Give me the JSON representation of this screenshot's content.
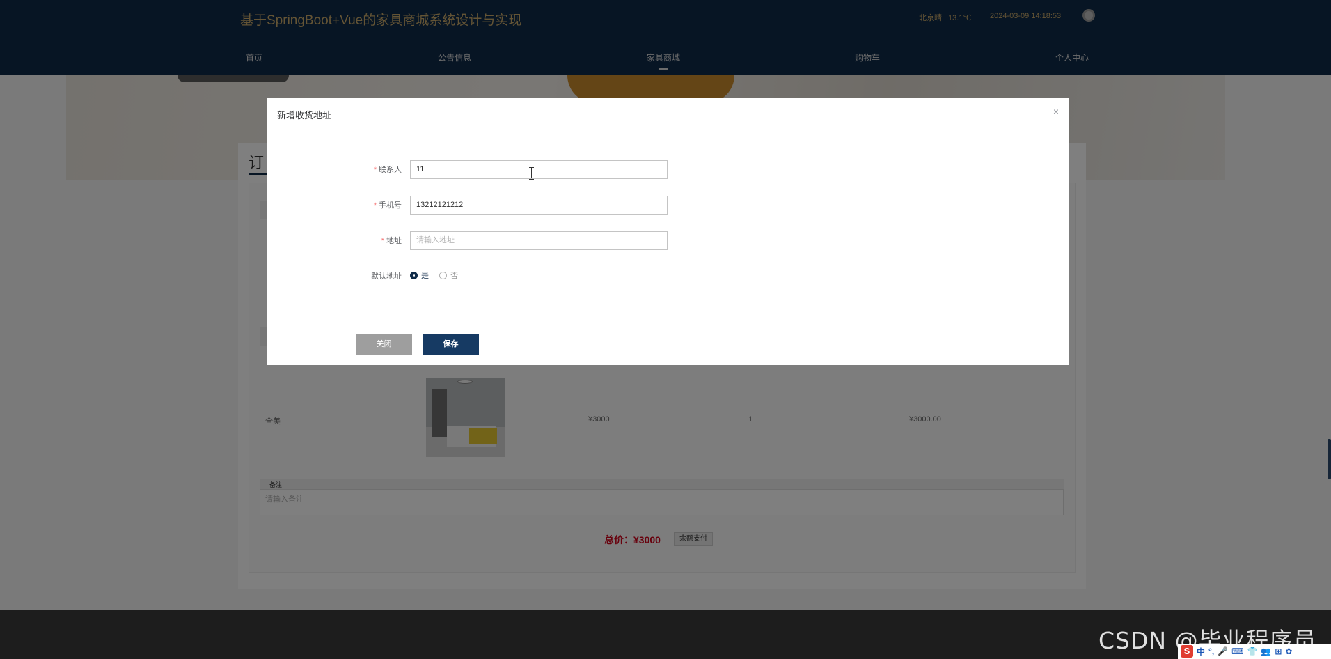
{
  "header": {
    "site_title": "基于SpringBoot+Vue的家具商城系统设计与实现",
    "weather": "北京晴 | 13.1℃",
    "datetime": "2024-03-09  14:18:53"
  },
  "nav": {
    "items": [
      {
        "label": "首页",
        "active": false
      },
      {
        "label": "公告信息",
        "active": false
      },
      {
        "label": "家具商城",
        "active": true
      },
      {
        "label": "购物车",
        "active": false
      },
      {
        "label": "个人中心",
        "active": false
      }
    ]
  },
  "order": {
    "tab_label": "订",
    "row": {
      "name": "全美",
      "price": "¥3000",
      "quantity": "1",
      "subtotal": "¥3000.00"
    },
    "remark_label": "备注",
    "remark_placeholder": "请输入备注",
    "total_label": "总价：¥3000",
    "pay_button": "余额支付"
  },
  "modal": {
    "title": "新增收货地址",
    "close_icon": "×",
    "fields": {
      "contact": {
        "label": "联系人",
        "value": "11"
      },
      "phone": {
        "label": "手机号",
        "value": "13212121212"
      },
      "address": {
        "label": "地址",
        "placeholder": "请输入地址"
      }
    },
    "default_address": {
      "label": "默认地址",
      "options": [
        {
          "label": "是",
          "checked": true
        },
        {
          "label": "否",
          "checked": false
        }
      ]
    },
    "close_button": "关闭",
    "save_button": "保存"
  },
  "watermark": "CSDN @毕业程序员",
  "ime": {
    "logo": "S",
    "items": [
      "中",
      "°,",
      "🎤",
      "⌨",
      "👕",
      "👥",
      "⊞",
      "✿"
    ]
  },
  "colors": {
    "header_bg": "#0f2a48",
    "accent_gold": "#c9a96a",
    "save_button": "#163a63",
    "close_button": "#9e9e9e",
    "required": "#f56c6c",
    "total_price": "#d0021b"
  }
}
